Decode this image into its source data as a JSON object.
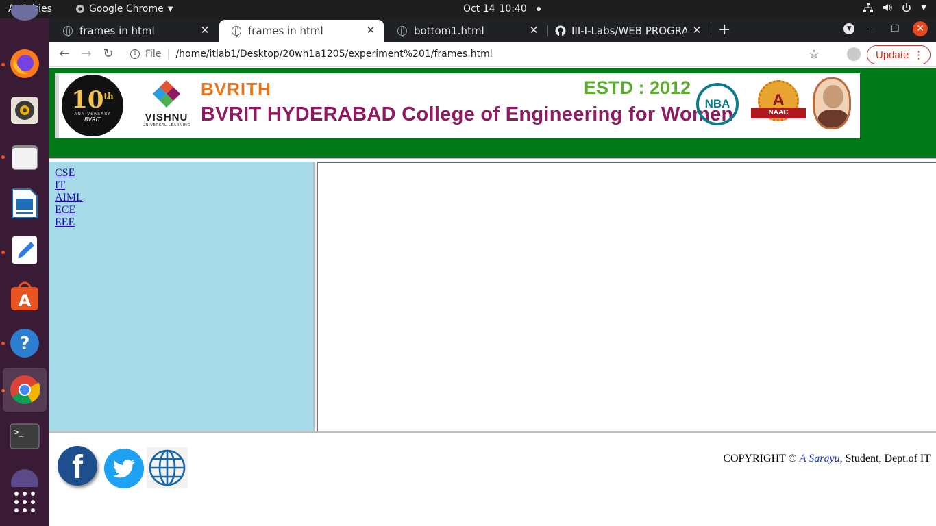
{
  "system": {
    "activities": "Activities",
    "app_name": "Google Chrome",
    "date": "Oct 14",
    "time": "10:40"
  },
  "dock": [
    {
      "name": "firefox"
    },
    {
      "name": "rhythmbox"
    },
    {
      "name": "files"
    },
    {
      "name": "libreoffice-impress"
    },
    {
      "name": "text-editor"
    },
    {
      "name": "ubuntu-software"
    },
    {
      "name": "help"
    },
    {
      "name": "chrome"
    },
    {
      "name": "terminal"
    },
    {
      "name": "show-applications"
    }
  ],
  "browser": {
    "tabs": [
      {
        "title": "frames in html",
        "active": false
      },
      {
        "title": "frames in html",
        "active": true
      },
      {
        "title": "bottom1.html",
        "active": false
      },
      {
        "title": "III-I-Labs/WEB PROGRAM",
        "active": false
      }
    ],
    "url_scheme": "File",
    "url": "/home/itlab1/Desktop/20wh1a1205/experiment%201/frames.html",
    "update_label": "Update"
  },
  "page": {
    "banner": {
      "anniversary_number": "10",
      "anniversary_suffix": "th",
      "anniversary_word": "ANNIVERSARY",
      "anniversary_brand": "BVRIT",
      "vishnu_name": "VISHNU",
      "vishnu_tagline": "UNIVERSAL LEARNING",
      "short_name": "BVRITH",
      "college_name": "BVRIT HYDERABAD College of Engineering for Women",
      "established": "ESTD : 2012",
      "nba": "NBA",
      "naac_grade": "A",
      "naac": "NAAC"
    },
    "menu_links": [
      "CSE",
      "IT",
      "AIML",
      "ECE",
      "EEE"
    ],
    "footer": {
      "copyright_prefix": "COPYRIGHT © ",
      "author": "A Sarayu",
      "copyright_suffix": ", Student, Dept.of IT"
    },
    "colors": {
      "header_bg": "#007a19",
      "menu_bg": "#a6dae6"
    }
  }
}
